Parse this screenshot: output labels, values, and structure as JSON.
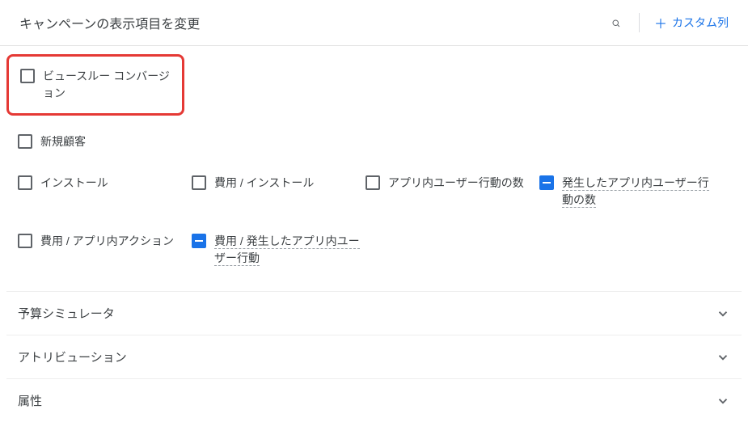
{
  "header": {
    "title": "キャンペーンの表示項目を変更",
    "custom_column": "カスタム列"
  },
  "items": {
    "view_through_conv": "ビュースルー コンバージョン",
    "new_customer": "新規顧客",
    "install": "インストール",
    "cost_per_install": "費用 / インストール",
    "in_app_actions_count": "アプリ内ユーザー行動の数",
    "occurred_in_app_actions_count": "発生したアプリ内ユーザー行動の数",
    "cost_per_in_app_action": "費用 / アプリ内アクション",
    "cost_per_occurred_action": "費用 / 発生したアプリ内ユーザー行動"
  },
  "sections": {
    "budget_simulator": "予算シミュレータ",
    "attribution": "アトリビューション",
    "attributes": "属性"
  }
}
